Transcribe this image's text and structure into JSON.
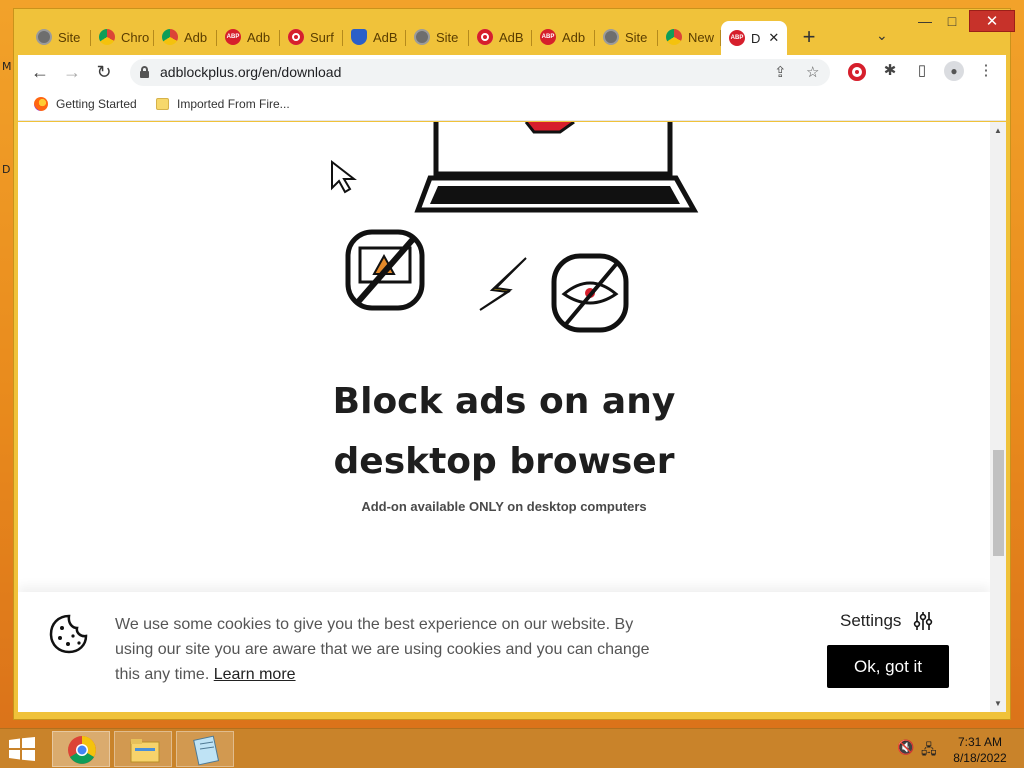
{
  "desktop": {
    "edge_letters": [
      "M",
      "D"
    ]
  },
  "tabs": [
    {
      "title": "Site",
      "icon": "globe-icon"
    },
    {
      "title": "Chro",
      "icon": "chrome-icon"
    },
    {
      "title": "Adb",
      "icon": "chrome-icon"
    },
    {
      "title": "Adb",
      "icon": "abp-icon"
    },
    {
      "title": "Surf",
      "icon": "opera-icon"
    },
    {
      "title": "AdB",
      "icon": "shield-icon"
    },
    {
      "title": "Site",
      "icon": "globe-icon"
    },
    {
      "title": "AdB",
      "icon": "opera-icon"
    },
    {
      "title": "Adb",
      "icon": "abp-icon"
    },
    {
      "title": "Site",
      "icon": "globe-icon"
    },
    {
      "title": "New",
      "icon": "chrome-icon"
    },
    {
      "title": "D",
      "icon": "abp-icon",
      "active": true
    }
  ],
  "abp_badge": "ABP",
  "window_controls": {
    "minimize": "—",
    "maximize": "□",
    "close": "✕"
  },
  "toolbar": {
    "url": "adblockplus.org/en/download"
  },
  "bookmarks": [
    {
      "label": "Getting Started",
      "icon": "firefox-icon"
    },
    {
      "label": "Imported From Fire...",
      "icon": "folder-icon"
    }
  ],
  "page": {
    "headline_line1": "Block ads on any",
    "headline_line2": "desktop browser",
    "subheading": "Add-on available ONLY on desktop computers"
  },
  "cookie_banner": {
    "text": "We use some cookies to give you the best experience on our website. By using our site you are aware that we are using cookies and you can change this any time.",
    "learn_more": "Learn more",
    "settings_label": "Settings",
    "ok_label": "Ok, got it"
  },
  "taskbar": {
    "time": "7:31 AM",
    "date": "8/18/2022"
  },
  "colors": {
    "desktop": "#e8891c",
    "tabstrip": "#f0c23a",
    "close_button": "#c7322a",
    "abp_red": "#d61f2c",
    "bolt_yellow": "#f5c518"
  }
}
